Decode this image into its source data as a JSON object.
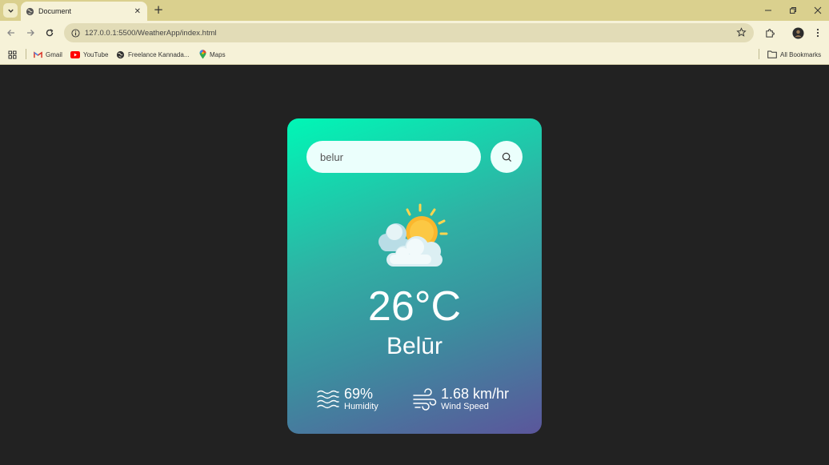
{
  "browser": {
    "tab_title": "Document",
    "url": "127.0.0.1:5500/WeatherApp/index.html",
    "bookmarks": [
      {
        "label": "Gmail",
        "icon": "gmail-icon"
      },
      {
        "label": "YouTube",
        "icon": "youtube-icon"
      },
      {
        "label": "Freelance Kannada...",
        "icon": "globe-icon"
      },
      {
        "label": "Maps",
        "icon": "maps-icon"
      }
    ],
    "all_bookmarks_label": "All Bookmarks"
  },
  "weather": {
    "search_value": "belur",
    "temperature": "26°C",
    "city": "Belūr",
    "humidity_value": "69%",
    "humidity_label": "Humidity",
    "wind_value": "1.68 km/hr",
    "wind_label": "Wind Speed",
    "condition_icon": "partly-cloudy-icon"
  },
  "colors": {
    "page_bg": "#222222",
    "gradient_start": "#00f7b6",
    "gradient_end": "#5b569b",
    "chrome_bg": "#f6f2d8",
    "tabbar_bg": "#dad08e"
  }
}
